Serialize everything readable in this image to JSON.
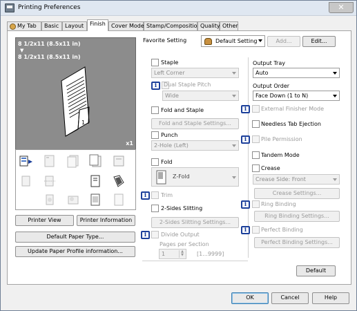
{
  "window": {
    "title": "Printing Preferences",
    "close": "✕"
  },
  "tabs": [
    "My Tab",
    "Basic",
    "Layout",
    "Finish",
    "Cover Mode",
    "Stamp/Composition",
    "Quality",
    "Other"
  ],
  "preview": {
    "line1": "8 1/2x11 (8.5x11 in)",
    "arrow": "▼",
    "line2": "8 1/2x11 (8.5x11 in)",
    "page_num": "1",
    "copies": "x1"
  },
  "left_buttons": {
    "printer_view": "Printer View",
    "printer_info": "Printer Information",
    "default_paper": "Default Paper Type...",
    "update_profile": "Update Paper Profile information..."
  },
  "favorite": {
    "label": "Favorite Setting",
    "value": "Default Setting",
    "add": "Add...",
    "edit": "Edit..."
  },
  "staple": {
    "label": "Staple",
    "position": "Left Corner",
    "dual_label": "Dual Staple Pitch",
    "dual_value": "Wide"
  },
  "fold_staple": {
    "label": "Fold and Staple",
    "settings": "Fold and Staple Settings..."
  },
  "punch": {
    "label": "Punch",
    "value": "2-Hole (Left)"
  },
  "fold": {
    "label": "Fold",
    "value": "Z-Fold"
  },
  "trim": {
    "label": "Trim"
  },
  "slitting": {
    "label": "2-Sides Slitting",
    "settings": "2-Sides Slitting Settings..."
  },
  "divide": {
    "label": "Divide Output",
    "pages_label": "Pages per Section",
    "pages_value": "1",
    "range": "[1...9999]"
  },
  "output_tray": {
    "label": "Output Tray",
    "value": "Auto"
  },
  "output_order": {
    "label": "Output Order",
    "value": "Face Down (1 to N)"
  },
  "ext_finisher": {
    "label": "External Finisher Mode"
  },
  "needless_tab": {
    "label": "Needless Tab Ejection"
  },
  "pile_perm": {
    "label": "Pile Permission"
  },
  "tandem": {
    "label": "Tandem Mode"
  },
  "crease": {
    "label": "Crease",
    "side": "Crease Side: Front",
    "settings": "Crease Settings..."
  },
  "ring": {
    "label": "Ring Binding",
    "settings": "Ring Binding Settings..."
  },
  "perfect": {
    "label": "Perfect Binding",
    "settings": "Perfect Binding Settings..."
  },
  "default_button": "Default",
  "footer": {
    "ok": "OK",
    "cancel": "Cancel",
    "help": "Help"
  },
  "info_glyph": "i",
  "colors": {
    "info_blue": "#1b3f9a",
    "preview_bg": "#8c8c8c"
  }
}
